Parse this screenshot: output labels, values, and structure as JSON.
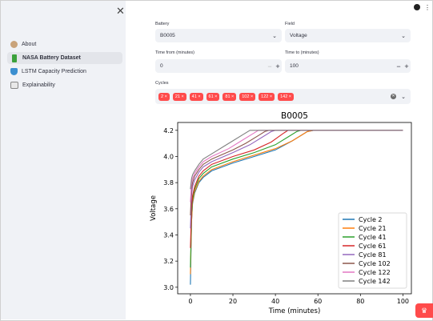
{
  "sidebar": {
    "items": [
      {
        "label": "About",
        "icon": "person-icon",
        "active": false
      },
      {
        "label": "NASA Battery Dataset",
        "icon": "battery-icon",
        "active": true
      },
      {
        "label": "LSTM Capacity Prediction",
        "icon": "bowl-icon",
        "active": false
      },
      {
        "label": "Explainability",
        "icon": "book-icon",
        "active": false
      }
    ]
  },
  "controls": {
    "battery_label": "Battery",
    "battery_value": "B0005",
    "field_label": "Field",
    "field_value": "Voltage",
    "time_from_label": "Time from (minutes)",
    "time_from_value": "0",
    "time_to_label": "Time to (minutes)",
    "time_to_value": "100",
    "cycles_label": "Cycles",
    "cycles": [
      "2 ×",
      "21 ×",
      "41 ×",
      "61 ×",
      "81 ×",
      "102 ×",
      "122 ×",
      "142 ×"
    ]
  },
  "chart_data": {
    "type": "line",
    "title": "B0005",
    "xlabel": "Time (minutes)",
    "ylabel": "Voltage",
    "xlim": [
      -6,
      104
    ],
    "ylim": [
      2.95,
      4.26
    ],
    "xticks": [
      0,
      20,
      40,
      60,
      80,
      100
    ],
    "yticks": [
      3.0,
      3.2,
      3.4,
      3.6,
      3.8,
      4.0,
      4.2
    ],
    "legend": "bottom-right",
    "series": [
      {
        "name": "Cycle 2",
        "color": "#1f77b4",
        "points": [
          [
            0,
            3.02
          ],
          [
            0.5,
            3.5
          ],
          [
            1,
            3.64
          ],
          [
            2,
            3.72
          ],
          [
            4,
            3.8
          ],
          [
            6,
            3.84
          ],
          [
            10,
            3.89
          ],
          [
            20,
            3.95
          ],
          [
            30,
            4.0
          ],
          [
            40,
            4.05
          ],
          [
            48,
            4.12
          ],
          [
            55,
            4.19
          ],
          [
            58,
            4.2
          ],
          [
            100,
            4.2
          ]
        ]
      },
      {
        "name": "Cycle 21",
        "color": "#ff7f0e",
        "points": [
          [
            0,
            3.1
          ],
          [
            0.5,
            3.5
          ],
          [
            1,
            3.65
          ],
          [
            2,
            3.73
          ],
          [
            4,
            3.81
          ],
          [
            6,
            3.85
          ],
          [
            10,
            3.9
          ],
          [
            20,
            3.96
          ],
          [
            30,
            4.01
          ],
          [
            40,
            4.06
          ],
          [
            48,
            4.12
          ],
          [
            55,
            4.19
          ],
          [
            58,
            4.2
          ],
          [
            100,
            4.2
          ]
        ]
      },
      {
        "name": "Cycle 41",
        "color": "#2ca02c",
        "points": [
          [
            0,
            3.15
          ],
          [
            0.5,
            3.55
          ],
          [
            1,
            3.67
          ],
          [
            2,
            3.75
          ],
          [
            4,
            3.83
          ],
          [
            6,
            3.87
          ],
          [
            10,
            3.92
          ],
          [
            20,
            3.98
          ],
          [
            30,
            4.03
          ],
          [
            40,
            4.09
          ],
          [
            46,
            4.15
          ],
          [
            50,
            4.19
          ],
          [
            52,
            4.2
          ],
          [
            100,
            4.2
          ]
        ]
      },
      {
        "name": "Cycle 61",
        "color": "#d62728",
        "points": [
          [
            0,
            3.3
          ],
          [
            0.5,
            3.6
          ],
          [
            1,
            3.7
          ],
          [
            2,
            3.77
          ],
          [
            4,
            3.85
          ],
          [
            6,
            3.89
          ],
          [
            10,
            3.94
          ],
          [
            20,
            4.0
          ],
          [
            30,
            4.05
          ],
          [
            38,
            4.11
          ],
          [
            44,
            4.18
          ],
          [
            46,
            4.2
          ],
          [
            100,
            4.2
          ]
        ]
      },
      {
        "name": "Cycle 81",
        "color": "#9467bd",
        "points": [
          [
            0,
            3.45
          ],
          [
            0.5,
            3.7
          ],
          [
            1,
            3.77
          ],
          [
            2,
            3.82
          ],
          [
            4,
            3.88
          ],
          [
            6,
            3.92
          ],
          [
            10,
            3.96
          ],
          [
            20,
            4.03
          ],
          [
            28,
            4.09
          ],
          [
            34,
            4.15
          ],
          [
            38,
            4.19
          ],
          [
            40,
            4.2
          ],
          [
            100,
            4.2
          ]
        ]
      },
      {
        "name": "Cycle 102",
        "color": "#8c564b",
        "points": [
          [
            0,
            3.55
          ],
          [
            0.5,
            3.75
          ],
          [
            1,
            3.8
          ],
          [
            2,
            3.85
          ],
          [
            4,
            3.9
          ],
          [
            6,
            3.94
          ],
          [
            10,
            3.98
          ],
          [
            20,
            4.05
          ],
          [
            26,
            4.1
          ],
          [
            32,
            4.16
          ],
          [
            35,
            4.19
          ],
          [
            37,
            4.2
          ],
          [
            100,
            4.2
          ]
        ]
      },
      {
        "name": "Cycle 122",
        "color": "#e377c2",
        "points": [
          [
            0,
            3.65
          ],
          [
            0.5,
            3.8
          ],
          [
            1,
            3.83
          ],
          [
            2,
            3.87
          ],
          [
            4,
            3.92
          ],
          [
            6,
            3.96
          ],
          [
            10,
            4.0
          ],
          [
            18,
            4.06
          ],
          [
            24,
            4.12
          ],
          [
            29,
            4.17
          ],
          [
            32,
            4.2
          ],
          [
            100,
            4.2
          ]
        ]
      },
      {
        "name": "Cycle 142",
        "color": "#7f7f7f",
        "points": [
          [
            0,
            3.75
          ],
          [
            0.5,
            3.83
          ],
          [
            1,
            3.86
          ],
          [
            2,
            3.89
          ],
          [
            4,
            3.94
          ],
          [
            6,
            3.98
          ],
          [
            10,
            4.02
          ],
          [
            16,
            4.08
          ],
          [
            20,
            4.12
          ],
          [
            25,
            4.17
          ],
          [
            28,
            4.2
          ],
          [
            100,
            4.2
          ]
        ]
      }
    ]
  }
}
